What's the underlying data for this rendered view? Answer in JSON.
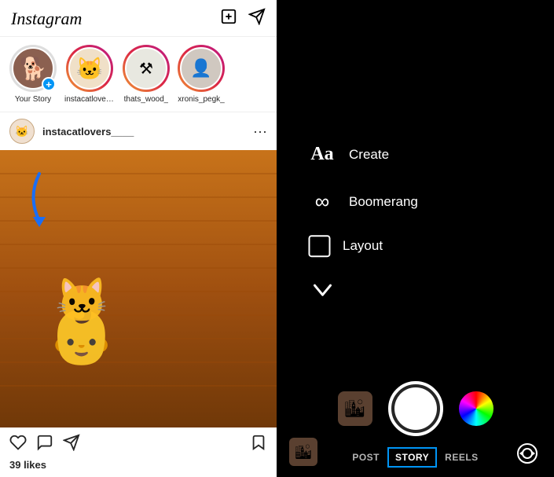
{
  "left": {
    "header": {
      "logo": "Instagram",
      "add_icon": "➕",
      "send_icon": "✈"
    },
    "stories": [
      {
        "id": "your-story",
        "label": "Your Story",
        "type": "your"
      },
      {
        "id": "instacatlovers",
        "label": "instacatlovers___",
        "type": "gradient"
      },
      {
        "id": "thats_wood",
        "label": "thats_wood_",
        "type": "gradient"
      },
      {
        "id": "xronis_pegk",
        "label": "xronis_pegk_",
        "type": "gradient-gray"
      }
    ],
    "post": {
      "username": "instacatlovers____",
      "more_icon": "⋯",
      "likes": "39 likes"
    },
    "actions": {
      "like": "♡",
      "comment": "💬",
      "share": "✈",
      "bookmark": "🔖"
    }
  },
  "right": {
    "options": [
      {
        "id": "create",
        "icon": "Aa",
        "label": "Create",
        "type": "text"
      },
      {
        "id": "boomerang",
        "icon": "∞",
        "label": "Boomerang",
        "type": "symbol"
      },
      {
        "id": "layout",
        "icon": "layout",
        "label": "Layout",
        "type": "layout"
      }
    ],
    "chevron": "∨",
    "modes": [
      {
        "id": "post",
        "label": "POST",
        "active": false
      },
      {
        "id": "story",
        "label": "STORY",
        "active": true
      },
      {
        "id": "reels",
        "label": "REELS",
        "active": false
      }
    ]
  }
}
